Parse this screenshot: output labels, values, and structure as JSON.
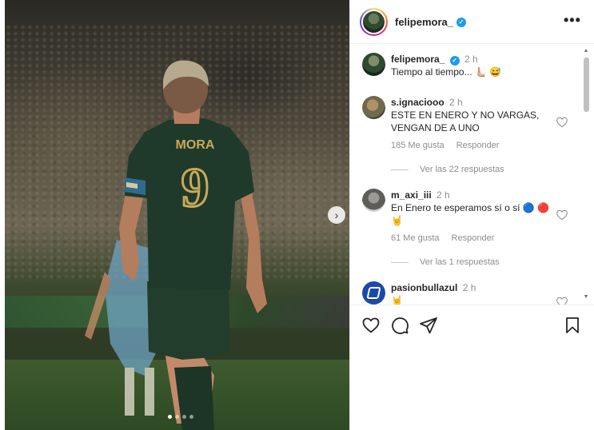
{
  "post": {
    "username": "felipemora_",
    "verified": true,
    "more_label": "•••",
    "carousel": {
      "slides": 4,
      "active_index": 0,
      "next_label": "›"
    }
  },
  "player_jersey": {
    "name": "MORA",
    "number": "9"
  },
  "comments": [
    {
      "username": "felipemora_",
      "verified": true,
      "time": "2 h",
      "text": "Tiempo al tiempo... 🫷🏼 😅",
      "is_caption": true
    },
    {
      "username": "s.ignaciooo",
      "time": "2 h",
      "text": "ESTE EN ENERO Y NO VARGAS, VENGAN DE A UNO",
      "likes": "185 Me gusta",
      "reply_label": "Responder",
      "view_replies": "Ver las 22 respuestas"
    },
    {
      "username": "m_axi_iii",
      "time": "2 h",
      "text": "En Enero te esperamos sí o sí 🔵 🔴 🤘",
      "likes": "61 Me gusta",
      "reply_label": "Responder",
      "view_replies": "Ver las 1 respuestas"
    },
    {
      "username": "pasionbullazul",
      "time": "2 h",
      "text": "🤘"
    }
  ],
  "actions": {
    "like_icon": "heart-icon",
    "comment_icon": "comment-icon",
    "share_icon": "share-icon",
    "save_icon": "bookmark-icon"
  },
  "colors": {
    "jersey_green": "#1f3a2a",
    "jersey_gold": "#c9a85a",
    "verified_blue": "#1d9bf0",
    "muted_text": "#8e8e8e"
  }
}
